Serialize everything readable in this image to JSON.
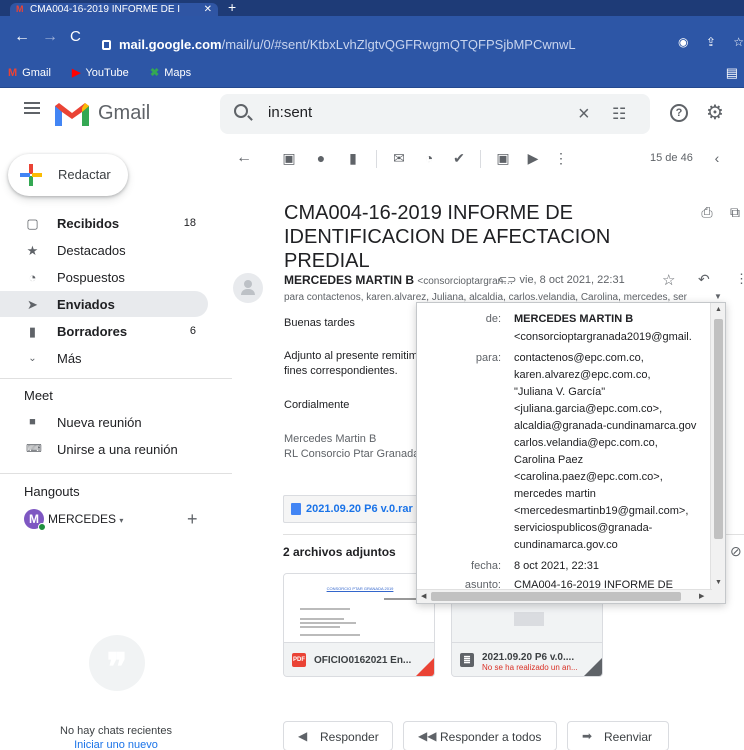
{
  "browser": {
    "tab_title": "CMA004-16-2019 INFORME DE I",
    "url_host": "mail.google.com",
    "url_path": "/mail/u/0/#sent/KtbxLvhZlgtvQGFRwgmQTQFPSjbMPCwnwL",
    "bookmarks": [
      {
        "label": "Gmail",
        "icon": "gmail-icon"
      },
      {
        "label": "YouTube",
        "icon": "youtube-icon"
      },
      {
        "label": "Maps",
        "icon": "maps-icon"
      }
    ]
  },
  "header": {
    "app_name": "Gmail",
    "search_value": "in:sent"
  },
  "sidebar": {
    "compose_label": "Redactar",
    "items": [
      {
        "label": "Recibidos",
        "count": "18",
        "icon": "inbox-icon",
        "bold": true
      },
      {
        "label": "Destacados",
        "count": "",
        "icon": "star-icon",
        "bold": false
      },
      {
        "label": "Pospuestos",
        "count": "",
        "icon": "clock-icon",
        "bold": false
      },
      {
        "label": "Enviados",
        "count": "",
        "icon": "send-icon",
        "bold": true,
        "active": true
      },
      {
        "label": "Borradores",
        "count": "6",
        "icon": "draft-icon",
        "bold": true
      },
      {
        "label": "Más",
        "count": "",
        "icon": "chevron-down-icon",
        "bold": false
      }
    ],
    "meet_title": "Meet",
    "meet_items": [
      {
        "label": "Nueva reunión",
        "icon": "video-icon"
      },
      {
        "label": "Unirse a una reunión",
        "icon": "keyboard-icon"
      }
    ],
    "hangouts_title": "Hangouts",
    "hangout_user": "MERCEDES",
    "avatar_letter": "M",
    "no_chats": "No hay chats recientes",
    "start_chat": "Iniciar uno nuevo"
  },
  "toolbar": {
    "pager": "15 de 46"
  },
  "message": {
    "subject": "CMA004-16-2019 INFORME DE IDENTIFICACION DE AFECTACION PREDIAL",
    "sender_name": "MERCEDES MARTIN B",
    "sender_email": "<consorcioptargran…",
    "date": "vie, 8 oct 2021, 22:31",
    "to_line": "para contactenos, karen.alvarez, Juliana, alcaldia, carlos.velandia, Carolina, mercedes, ser",
    "body": {
      "greeting": "Buenas tardes",
      "line1": "Adjunto al presente remitim",
      "line2": "fines correspondientes.",
      "closing": "Cordialmente",
      "sig1": "Mercedes Martin B",
      "sig2": "RL Consorcio Ptar Granada"
    },
    "drive_attachment": "2021.09.20 P6 v.0.rar",
    "attachments_title": "2 archivos adjuntos",
    "attachments": [
      {
        "name": "OFICIO0162021 En...",
        "sub": "",
        "type": "PDF",
        "color": "#ea4335"
      },
      {
        "name": "2021.09.20 P6 v.0....",
        "sub": "No se ha realizado un an...",
        "type": "FILE",
        "color": "#5f6368"
      }
    ],
    "thumb_heading": "CONSORCIO PTAR GRANADA  2019"
  },
  "popup": {
    "from_label": "de:",
    "from_name": "MERCEDES MARTIN B",
    "from_email": "<consorcioptargranada2019@gmail.",
    "to_label": "para:",
    "to_lines": [
      "contactenos@epc.com.co,",
      "karen.alvarez@epc.com.co,",
      "\"Juliana V. García\"",
      "<juliana.garcia@epc.com.co>,",
      "alcaldia@granada-cundinamarca.gov",
      "carlos.velandia@epc.com.co,",
      "Carolina Paez",
      "<carolina.paez@epc.com.co>,",
      "mercedes martin",
      "<mercedesmartinb19@gmail.com>,",
      "serviciospublicos@granada-",
      "cundinamarca.gov.co"
    ],
    "date_label": "fecha:",
    "date_value": "8 oct 2021, 22:31",
    "subject_label": "asunto:",
    "subject_value": "CMA004-16-2019 INFORME DE"
  },
  "actions": {
    "reply": "Responder",
    "reply_all": "Responder a todos",
    "forward": "Reenviar"
  },
  "colors": {
    "chrome_blue": "#2d56a6",
    "gmail_red": "#ea4335",
    "link_blue": "#1a73e8",
    "active_nav": "#e8eaed"
  }
}
